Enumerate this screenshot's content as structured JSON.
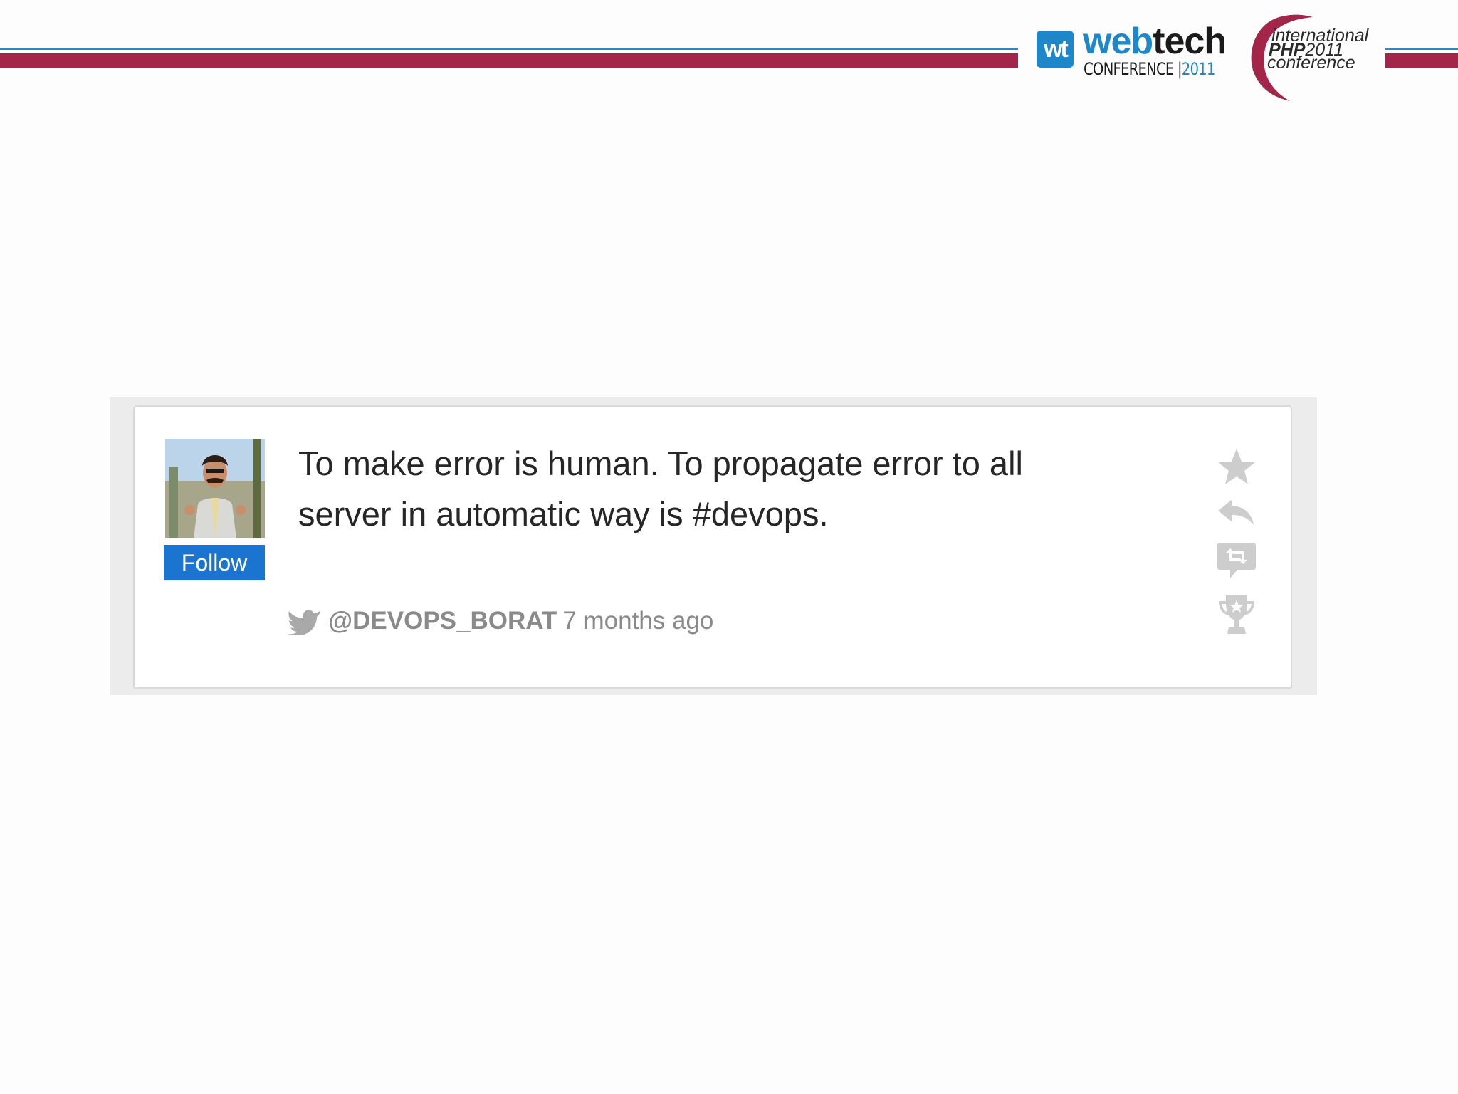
{
  "header": {
    "webtech_logo": {
      "badge": "wt",
      "word_part1": "web",
      "word_part2": "tech",
      "sub_part1": "CONFERENCE |",
      "sub_part2": "2011",
      "brand_color": "#1d87c9"
    },
    "php_logo": {
      "line1": "international",
      "line2_bold": "PHP",
      "line2_rest": "2011",
      "line3": "conference",
      "swoosh_color": "#a3264a"
    },
    "bar_colors": {
      "thin": "#2a86c4",
      "thick": "#a3264a"
    }
  },
  "tweet": {
    "text": "To make error is human. To propagate error to all server in automatic way is #devops.",
    "follow_label": "Follow",
    "handle": "@DEVOPS_BORAT",
    "time": "7 months ago",
    "icons": {
      "source": "twitter-bird-icon",
      "favorite": "star-icon",
      "reply": "reply-arrow-icon",
      "retweet": "retweet-icon",
      "award": "trophy-icon"
    },
    "accent_color": "#1a74d0"
  }
}
